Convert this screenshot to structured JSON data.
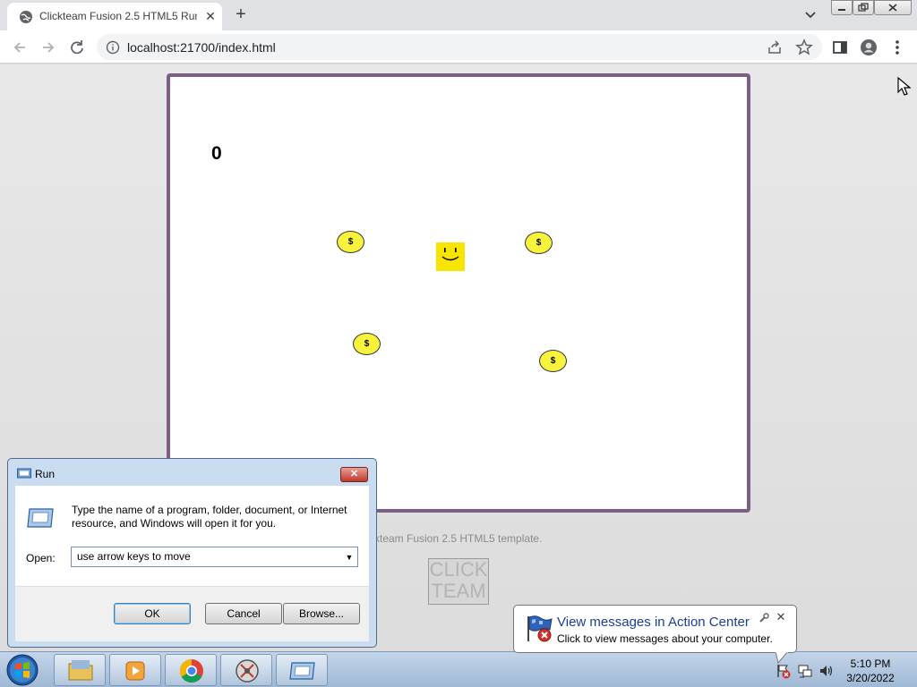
{
  "browser": {
    "tab_title": "Clickteam Fusion 2.5 HTML5 Run",
    "tab_close": "✕",
    "new_tab": "+",
    "url": "localhost:21700/index.html"
  },
  "game": {
    "score": "0",
    "coin_symbol": "$",
    "colors": {
      "coin": "#f7f33d",
      "player": "#f7e400",
      "frame": "#7a5f86"
    }
  },
  "page": {
    "template_text": "ckteam Fusion 2.5 HTML5 template.",
    "logo_line1": "CLICK",
    "logo_line2": "TEAM"
  },
  "run_dialog": {
    "title": "Run",
    "close": "✕",
    "description": "Type the name of a program, folder, document, or Internet resource, and Windows will open it for you.",
    "open_label": "Open:",
    "input_value": "use arrow keys to move",
    "ok": "OK",
    "cancel": "Cancel",
    "browse": "Browse..."
  },
  "notification": {
    "title": "View messages in Action Center",
    "text": "Click to view messages about your computer.",
    "close": "✕"
  },
  "taskbar": {
    "time": "5:10 PM",
    "date": "3/20/2022",
    "apps": [
      "file-explorer",
      "media-player",
      "chrome",
      "app-4",
      "run"
    ]
  }
}
